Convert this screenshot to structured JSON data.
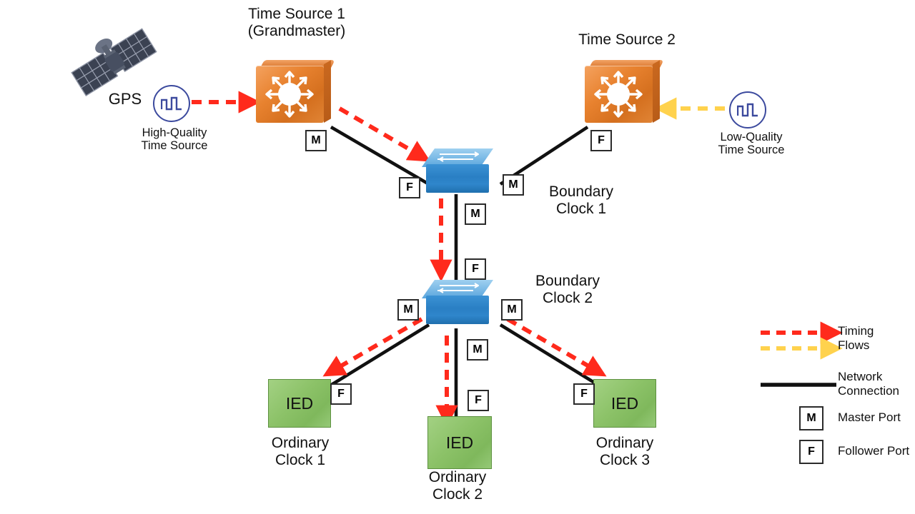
{
  "diagram": {
    "title_ts1": "Time Source 1\n(Grandmaster)",
    "title_ts2": "Time Source 2",
    "gps_label": "GPS",
    "hq_source": "High-Quality\nTime Source",
    "lq_source": "Low-Quality\nTime Source",
    "bc1_label": "Boundary\nClock 1",
    "bc2_label": "Boundary\nClock 2",
    "ied_label": "IED",
    "oc1_label": "Ordinary\nClock 1",
    "oc2_label": "Ordinary\nClock 2",
    "oc3_label": "Ordinary\nClock 3",
    "port_master": "M",
    "port_follower": "F"
  },
  "ports": [
    {
      "id": "ts1-m",
      "text": "M"
    },
    {
      "id": "ts2-f",
      "text": "F"
    },
    {
      "id": "bc1-f-left",
      "text": "F"
    },
    {
      "id": "bc1-m-right",
      "text": "M"
    },
    {
      "id": "bc1-m-down",
      "text": "M"
    },
    {
      "id": "bc2-f-up",
      "text": "F"
    },
    {
      "id": "bc2-m-left",
      "text": "M"
    },
    {
      "id": "bc2-m-right",
      "text": "M"
    },
    {
      "id": "bc2-m-down",
      "text": "M"
    },
    {
      "id": "oc1-f",
      "text": "F"
    },
    {
      "id": "oc2-f",
      "text": "F"
    },
    {
      "id": "oc3-f",
      "text": "F"
    }
  ],
  "legend": {
    "timing_flows": "Timing\nFlows",
    "network_connection": "Network\nConnection",
    "master_port_badge": "M",
    "master_port_text": "Master Port",
    "follower_port_badge": "F",
    "follower_port_text": "Follower Port"
  },
  "colors": {
    "timing_red": "#FF2A1C",
    "timing_yellow": "#FFD24D",
    "network_black": "#111111",
    "router_orange": "#E8822F",
    "switch_blue": "#2A7FC4",
    "ied_green": "#8CC268",
    "pulse_blue": "#3C4A9E"
  }
}
